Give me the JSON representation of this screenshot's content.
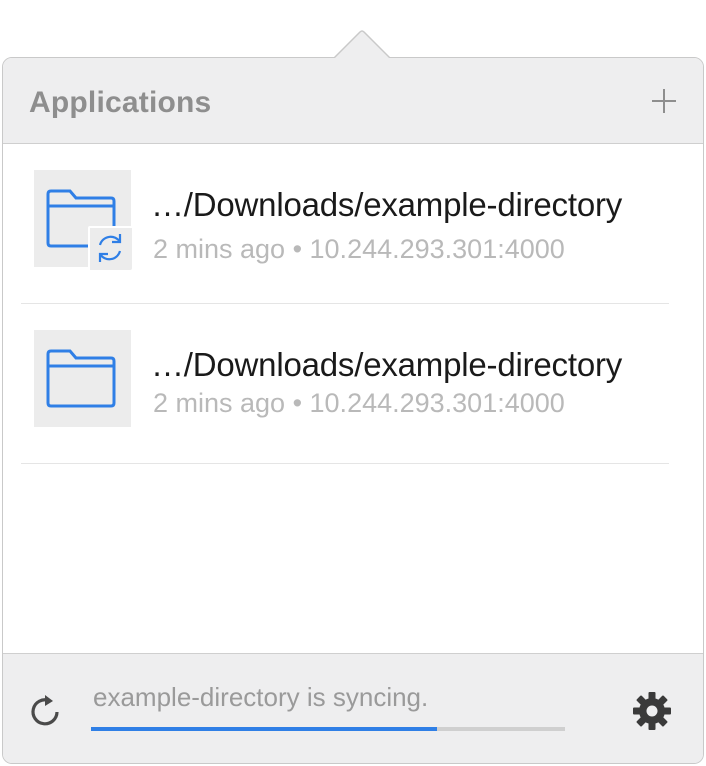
{
  "header": {
    "title": "Applications",
    "add_icon": "plus-icon"
  },
  "items": [
    {
      "path": "…/Downloads/example-directory",
      "meta": "2 mins ago • 10.244.293.301:4000",
      "icon": "folder-icon",
      "syncing": true
    },
    {
      "path": "…/Downloads/example-directory",
      "meta": "2 mins ago • 10.244.293.301:4000",
      "icon": "folder-icon",
      "syncing": false
    }
  ],
  "footer": {
    "status": "example-directory is syncing.",
    "progress_percent": 73,
    "refresh_icon": "refresh-icon",
    "settings_icon": "gear-icon"
  },
  "colors": {
    "accent": "#2f7fe6",
    "header_bg": "#eeeeef",
    "muted_text": "#b9b9b9"
  }
}
